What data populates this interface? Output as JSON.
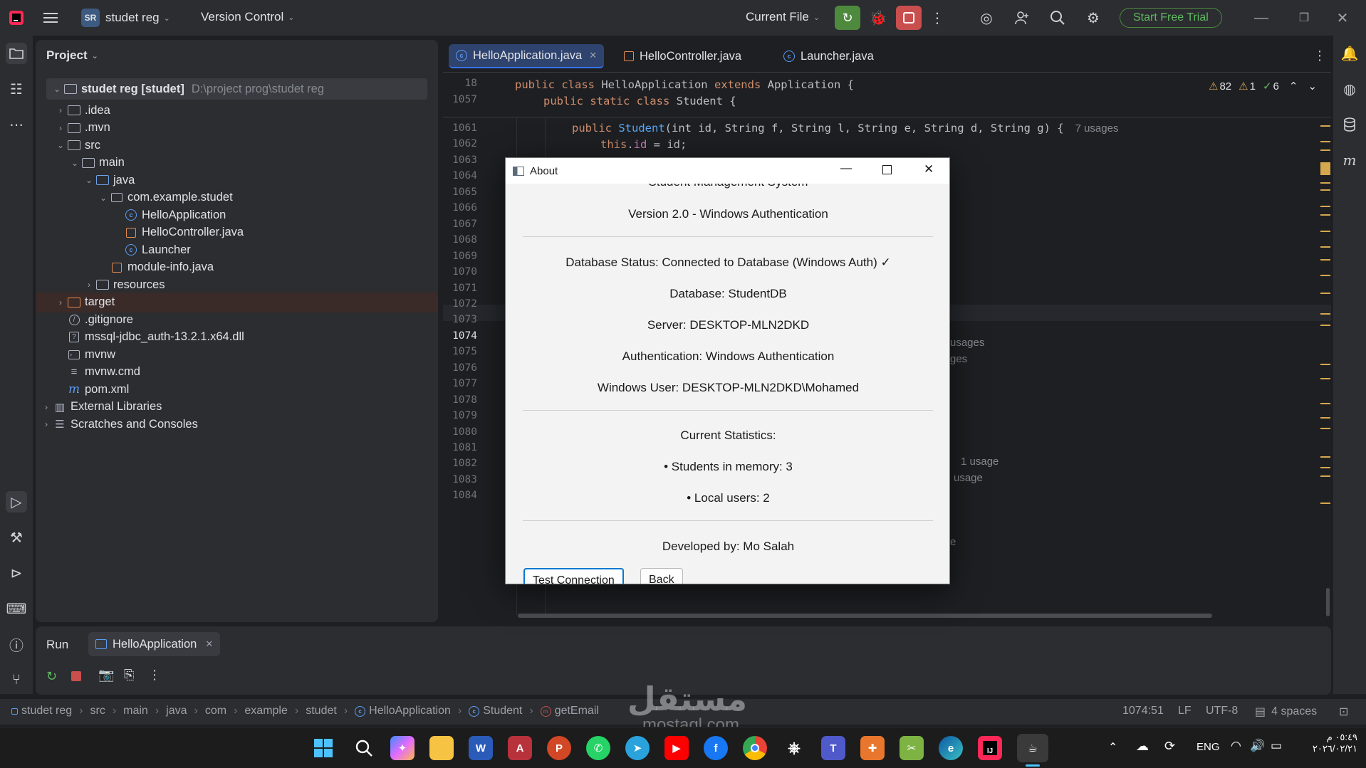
{
  "titlebar": {
    "project_badge": "SR",
    "project_name": "studet reg",
    "version_control": "Version Control",
    "run_config": "Current File",
    "trial_button": "Start Free Trial"
  },
  "project_panel": {
    "title": "Project",
    "root": {
      "label": "studet reg [studet]",
      "path": "D:\\project prog\\studet reg"
    },
    "items": [
      {
        "label": ".idea",
        "indent": 1,
        "arrow": "›",
        "icon": "folder"
      },
      {
        "label": ".mvn",
        "indent": 1,
        "arrow": "›",
        "icon": "folder"
      },
      {
        "label": "src",
        "indent": 1,
        "arrow": "⌄",
        "icon": "folder"
      },
      {
        "label": "main",
        "indent": 2,
        "arrow": "⌄",
        "icon": "folder"
      },
      {
        "label": "java",
        "indent": 3,
        "arrow": "⌄",
        "icon": "folder-blue"
      },
      {
        "label": "com.example.studet",
        "indent": 4,
        "arrow": "⌄",
        "icon": "package"
      },
      {
        "label": "HelloApplication",
        "indent": 5,
        "arrow": "",
        "icon": "class"
      },
      {
        "label": "HelloController.java",
        "indent": 5,
        "arrow": "",
        "icon": "java-file"
      },
      {
        "label": "Launcher",
        "indent": 5,
        "arrow": "",
        "icon": "class"
      },
      {
        "label": "module-info.java",
        "indent": 4,
        "arrow": "",
        "icon": "java-file"
      },
      {
        "label": "resources",
        "indent": 3,
        "arrow": "›",
        "icon": "folder"
      },
      {
        "label": "target",
        "indent": 1,
        "arrow": "›",
        "icon": "folder-orange"
      },
      {
        "label": ".gitignore",
        "indent": 1,
        "arrow": "",
        "icon": "ignore"
      },
      {
        "label": "mssql-jdbc_auth-13.2.1.x64.dll",
        "indent": 1,
        "arrow": "",
        "icon": "unknown"
      },
      {
        "label": "mvnw",
        "indent": 1,
        "arrow": "",
        "icon": "terminal"
      },
      {
        "label": "mvnw.cmd",
        "indent": 1,
        "arrow": "",
        "icon": "lines"
      },
      {
        "label": "pom.xml",
        "indent": 1,
        "arrow": "",
        "icon": "maven"
      },
      {
        "label": "External Libraries",
        "indent": 0,
        "arrow": "›",
        "icon": "library"
      },
      {
        "label": "Scratches and Consoles",
        "indent": 0,
        "arrow": "›",
        "icon": "scratch"
      }
    ]
  },
  "editor": {
    "tabs": [
      "HelloApplication.java",
      "HelloController.java",
      "Launcher.java"
    ],
    "inspection": {
      "warnings": "82",
      "weak": "1",
      "ok": "6"
    },
    "lines": [
      "18",
      "1057",
      "1061",
      "1062",
      "1063",
      "1064",
      "1065",
      "1066",
      "1067",
      "1068",
      "1069",
      "1070",
      "1071",
      "1072",
      "1073",
      "1074",
      "1075",
      "1076",
      "1077",
      "1078",
      "1079",
      "1080",
      "1081",
      "1082",
      "1083",
      "1084"
    ],
    "code": {
      "l18_kw1": "public class ",
      "l18_name": "HelloApplication ",
      "l18_kw2": "extends ",
      "l18_rest": "Application {",
      "l1057_kw": "public static class ",
      "l1057_rest": "Student {",
      "l1061_kw": "public ",
      "l1061_fn": "Student",
      "l1061_rest": "(int id, String f, String l, String e, String d, String g) {",
      "l1061_hint": "7 usages",
      "l1062_kw": "this",
      "l1062_dot": ".",
      "l1062_fld": "id",
      "l1062_rest": " = id;"
    },
    "hints": {
      "h1072": "usages",
      "h1073": "ges",
      "h1078": "1 usage",
      "h1079": "usage",
      "h1082": "e"
    }
  },
  "run_panel": {
    "title": "Run",
    "tab": "HelloApplication"
  },
  "statusbar": {
    "breadcrumbs": [
      "studet reg",
      "src",
      "main",
      "java",
      "com",
      "example",
      "studet",
      "HelloApplication",
      "Student",
      "getEmail"
    ],
    "position": "1074:51",
    "line_sep": "LF",
    "encoding": "UTF-8",
    "indent": "4 spaces"
  },
  "dialog": {
    "title": "About",
    "partial_top": "Student Management System",
    "version": "Version 2.0 - Windows Authentication",
    "db_status": "Database Status: Connected to Database (Windows Auth) ✓",
    "database": "Database: StudentDB",
    "server": "Server: DESKTOP-MLN2DKD",
    "auth": "Authentication: Windows Authentication",
    "user": "Windows User: DESKTOP-MLN2DKD\\Mohamed",
    "stats_title": "Current Statistics:",
    "students": "• Students in memory: 3",
    "local_users": "• Local users: 2",
    "developer": "Developed by: Mo Salah",
    "btn_test": "Test Connection",
    "btn_back": "Back"
  },
  "watermark": {
    "arabic": "مستقل",
    "latin": "mostaql.com"
  },
  "taskbar": {
    "lang": "ENG",
    "time": "٠٥:٤٩ م",
    "date": "٢٠٢٦/٠٢/٢١"
  },
  "colors": {
    "accent": "#3574f0",
    "warning": "#d6a84e",
    "run_green": "#4e8a3e",
    "stop_red": "#c94f4f"
  }
}
